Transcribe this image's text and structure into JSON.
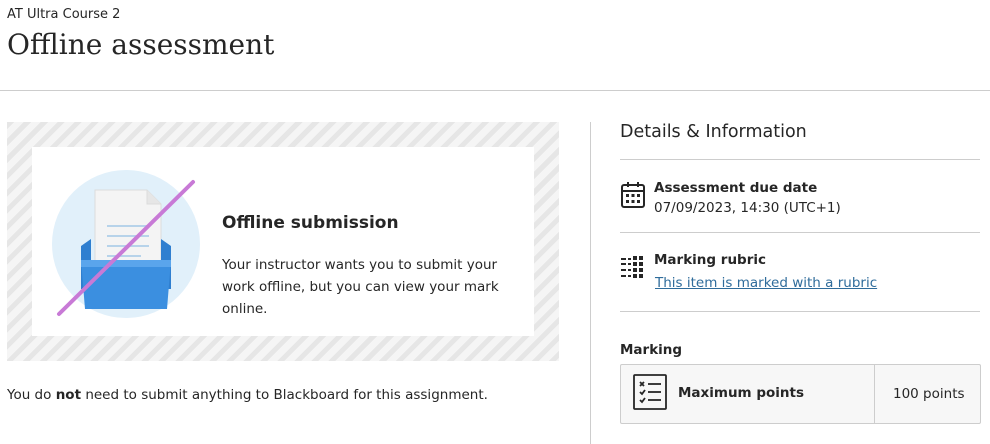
{
  "header": {
    "course_name": "AT Ultra Course 2",
    "page_title": "Offline assessment"
  },
  "offline_card": {
    "title": "Offline submission",
    "text": "Your instructor wants you to submit your work offline, but you can view your mark online.",
    "illustration": "offline-tray-illustration"
  },
  "footnote": {
    "before": "You do ",
    "emphasis": "not",
    "after": " need to submit anything to Blackboard for this assignment."
  },
  "details": {
    "heading": "Details & Information",
    "due_date": {
      "label": "Assessment due date",
      "value": "07/09/2023, 14:30 (UTC+1)",
      "icon": "calendar-icon"
    },
    "rubric": {
      "label": "Marking rubric",
      "link": "This item is marked with a rubric",
      "icon": "rubric-grid-icon"
    }
  },
  "marking": {
    "label": "Marking",
    "points_label": "Maximum points",
    "points_value": "100 points",
    "icon": "checklist-icon"
  },
  "colors": {
    "link": "#2f6c9b",
    "illustration_circle": "#e1f0fa",
    "tray": "#3b8fe0",
    "strike": "#c87ad6",
    "divider": "#cdcdcd"
  }
}
